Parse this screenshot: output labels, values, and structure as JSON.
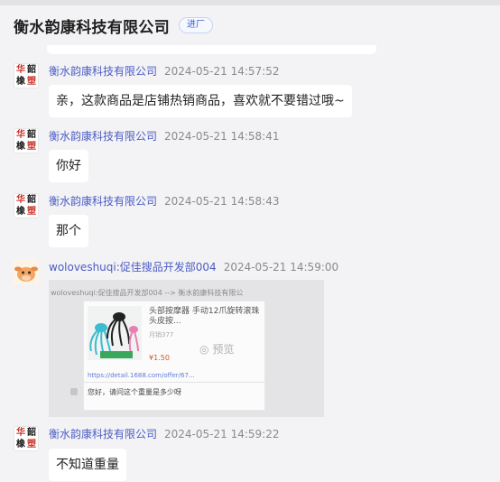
{
  "header": {
    "title": "衡水韵康科技有限公司",
    "badge": "进厂"
  },
  "messages": [
    {
      "sender": "衡水韵康科技有限公司",
      "time": "2024-05-21 14:57:52",
      "text": "亲，这款商品是店铺热销商品，喜欢就不要错过哦~"
    },
    {
      "sender": "衡水韵康科技有限公司",
      "time": "2024-05-21 14:58:41",
      "text": "你好"
    },
    {
      "sender": "衡水韵康科技有限公司",
      "time": "2024-05-21 14:58:43",
      "text": "那个"
    },
    {
      "sender": "woloveshuqi:促佳搜品开发部004",
      "time": "2024-05-21 14:59:00"
    },
    {
      "sender": "衡水韵康科技有限公司",
      "time": "2024-05-21 14:59:22",
      "text": "不知道重量"
    }
  ],
  "shop_avatar": {
    "chars": [
      "华",
      "韶",
      "橡",
      "塑"
    ],
    "colors": [
      "#c8352b",
      "#1a1a1a",
      "#1a1a1a",
      "#c8352b"
    ]
  },
  "screenshot": {
    "header": "woloveshuqi:促佳搜品开发部004 --> 衡水韵康科技有限公",
    "product_title": "头部按摩器 手动12爪旋转滚珠头皮按...",
    "sales": "月销377",
    "price": "¥1.50",
    "preview": "预览",
    "link": "https://detail.1688.com/offer/67...",
    "question": "您好，请问这个重量是多少呀"
  },
  "colors": {
    "background": "#f3f3f5",
    "sender": "#4b5cc4",
    "time": "#8a8a8a",
    "bubble": "#ffffff"
  }
}
